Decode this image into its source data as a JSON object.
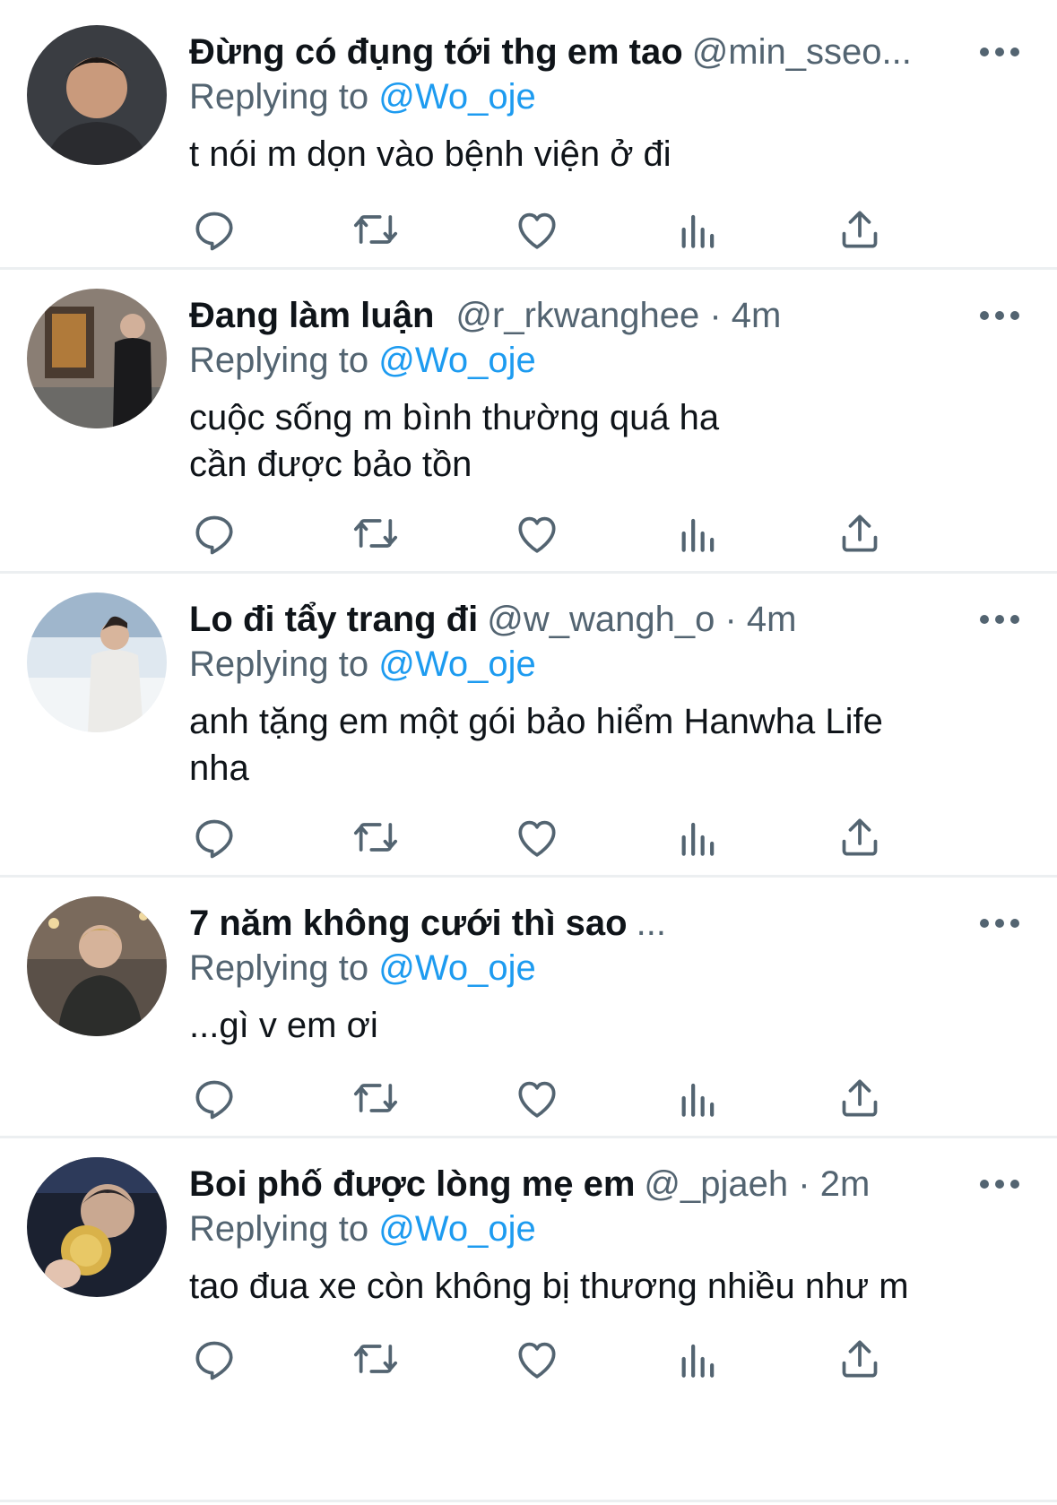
{
  "colors": {
    "text": "#0f1419",
    "secondary": "#536471",
    "link": "#1d9bf0",
    "divider": "#eceff1"
  },
  "icons": {
    "reply": "reply-icon",
    "retweet": "retweet-icon",
    "like": "heart-icon",
    "views": "analytics-icon",
    "share": "share-icon",
    "more": "more-icon"
  },
  "tweets": [
    {
      "name": "Đừng có đụng tới thg em tao",
      "handle_time": "@min_sseo...",
      "replying_label": "Replying to ",
      "replying_to": "@Wo_oje",
      "text": "t nói m dọn vào bệnh viện ở đi"
    },
    {
      "name": "Đang làm luận",
      "handle_time": "@r_rkwanghee · 4m",
      "replying_label": "Replying to ",
      "replying_to": "@Wo_oje",
      "text": "cuộc sống m bình thường quá ha\ncần được bảo tồn"
    },
    {
      "name": "Lo đi tẩy trang đi",
      "handle_time": "@w_wangh_o · 4m",
      "replying_label": "Replying to ",
      "replying_to": "@Wo_oje",
      "text": "anh tặng em một gói bảo hiểm Hanwha Life\nnha"
    },
    {
      "name": "7 năm không cưới thì sao",
      "handle_time": "...",
      "replying_label": "Replying to ",
      "replying_to": "@Wo_oje",
      "text": "...gì v em ơi"
    },
    {
      "name": "Boi phố được lòng mẹ em",
      "handle_time": "@_pjaeh · 2m",
      "replying_label": "Replying to ",
      "replying_to": "@Wo_oje",
      "text": "tao đua xe còn không bị thương nhiều như m"
    }
  ]
}
